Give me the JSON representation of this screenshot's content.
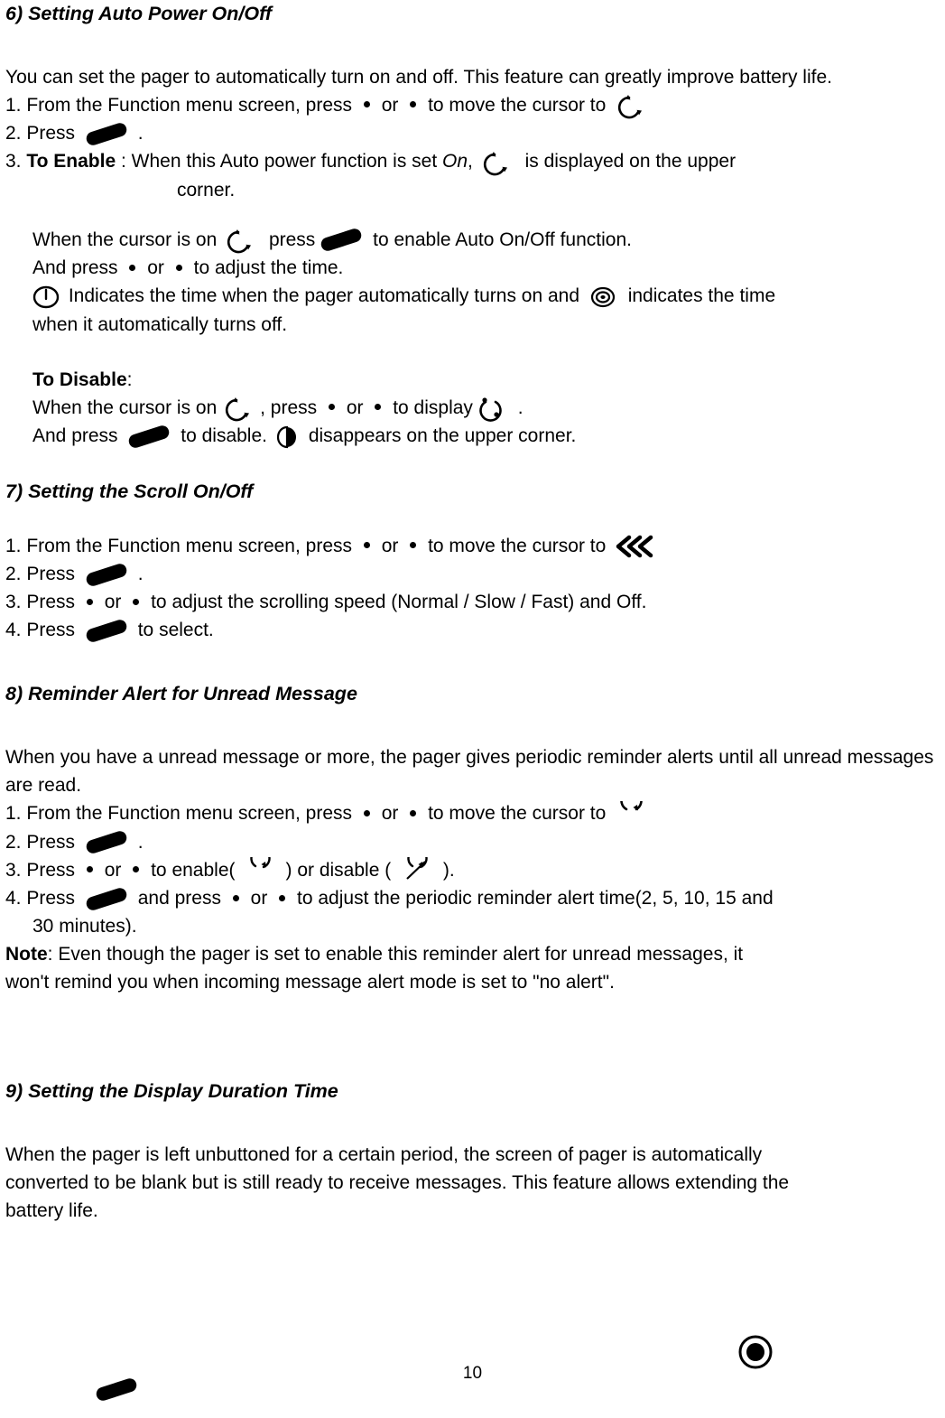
{
  "document": {
    "page_number": "10",
    "sections": [
      {
        "heading": "6) Setting Auto Power On/Off",
        "intro": "You can set the pager to automatically turn on and off. This feature can greatly improve battery life.",
        "step1_a": "1. From the Function menu screen, press",
        "or": "or",
        "step1_b": "to move the cursor to",
        "step2": "2. Press",
        "period": ".",
        "step3_label": "3.",
        "to_enable": "To Enable",
        "to_enable_a": ": When this Auto power function is set",
        "on_word": "On",
        "comma": ",",
        "to_enable_b": "is displayed on the upper",
        "to_enable_c": "corner.",
        "cursor_on_a": "When the cursor is on",
        "press_word": "press",
        "cursor_on_b": "to enable Auto On/Off function.",
        "and_press_adjust": "And press",
        "adjust_time": "to adjust the time.",
        "indicates_a": "Indicates the time when the pager automatically turns on and",
        "indicates_b": "indicates the time",
        "indicates_c": "when it automatically turns off.",
        "to_disable": "To Disable",
        "to_disable_colon": ":",
        "disable_line_a": "When the cursor is on",
        "disable_line_a2": ", press",
        "disable_line_a3": "to display",
        "disable_line_a4": ".",
        "disable_line_b": "And press",
        "disable_line_b2": "to disable.",
        "disable_line_b3": "disappears on the upper corner."
      },
      {
        "heading": "7) Setting the Scroll On/Off",
        "step1_a": "1. From the Function menu screen, press",
        "or": "or",
        "step1_b": "to move the cursor to",
        "step2": "2. Press",
        "period": ".",
        "step3_a": "3. Press",
        "step3_b": "to adjust the scrolling speed (Normal / Slow / Fast) and Off.",
        "step4_a": "4. Press",
        "step4_b": "to select."
      },
      {
        "heading": "8) Reminder Alert for Unread Message",
        "intro": "When you have a unread message or more, the pager gives periodic reminder alerts until all unread messages are read.",
        "step1_a": "1. From the Function menu screen, press",
        "or": "or",
        "step1_b": "to move the cursor to",
        "step2": "2. Press",
        "period": ".",
        "step3_a": "3. Press",
        "step3_b": "to enable(",
        "step3_c": ") or disable (",
        "step3_d": ").",
        "step4_a": "4. Press",
        "step4_b": "and press",
        "step4_c": "to adjust the periodic reminder alert time(2, 5, 10, 15 and",
        "step4_d": "30 minutes).",
        "note_label": "Note",
        "note_a": ": Even though the pager is set to enable this reminder alert for unread messages, it",
        "note_b": "won't remind you when incoming message alert mode is set to \"no alert\"."
      },
      {
        "heading": "9) Setting the Display Duration Time",
        "intro_a": "When the pager is left unbuttoned for a certain period, the screen of pager is automatically",
        "intro_b": "converted to be blank but is still ready to receive messages. This feature allows extending the",
        "intro_c": "battery life."
      }
    ]
  }
}
